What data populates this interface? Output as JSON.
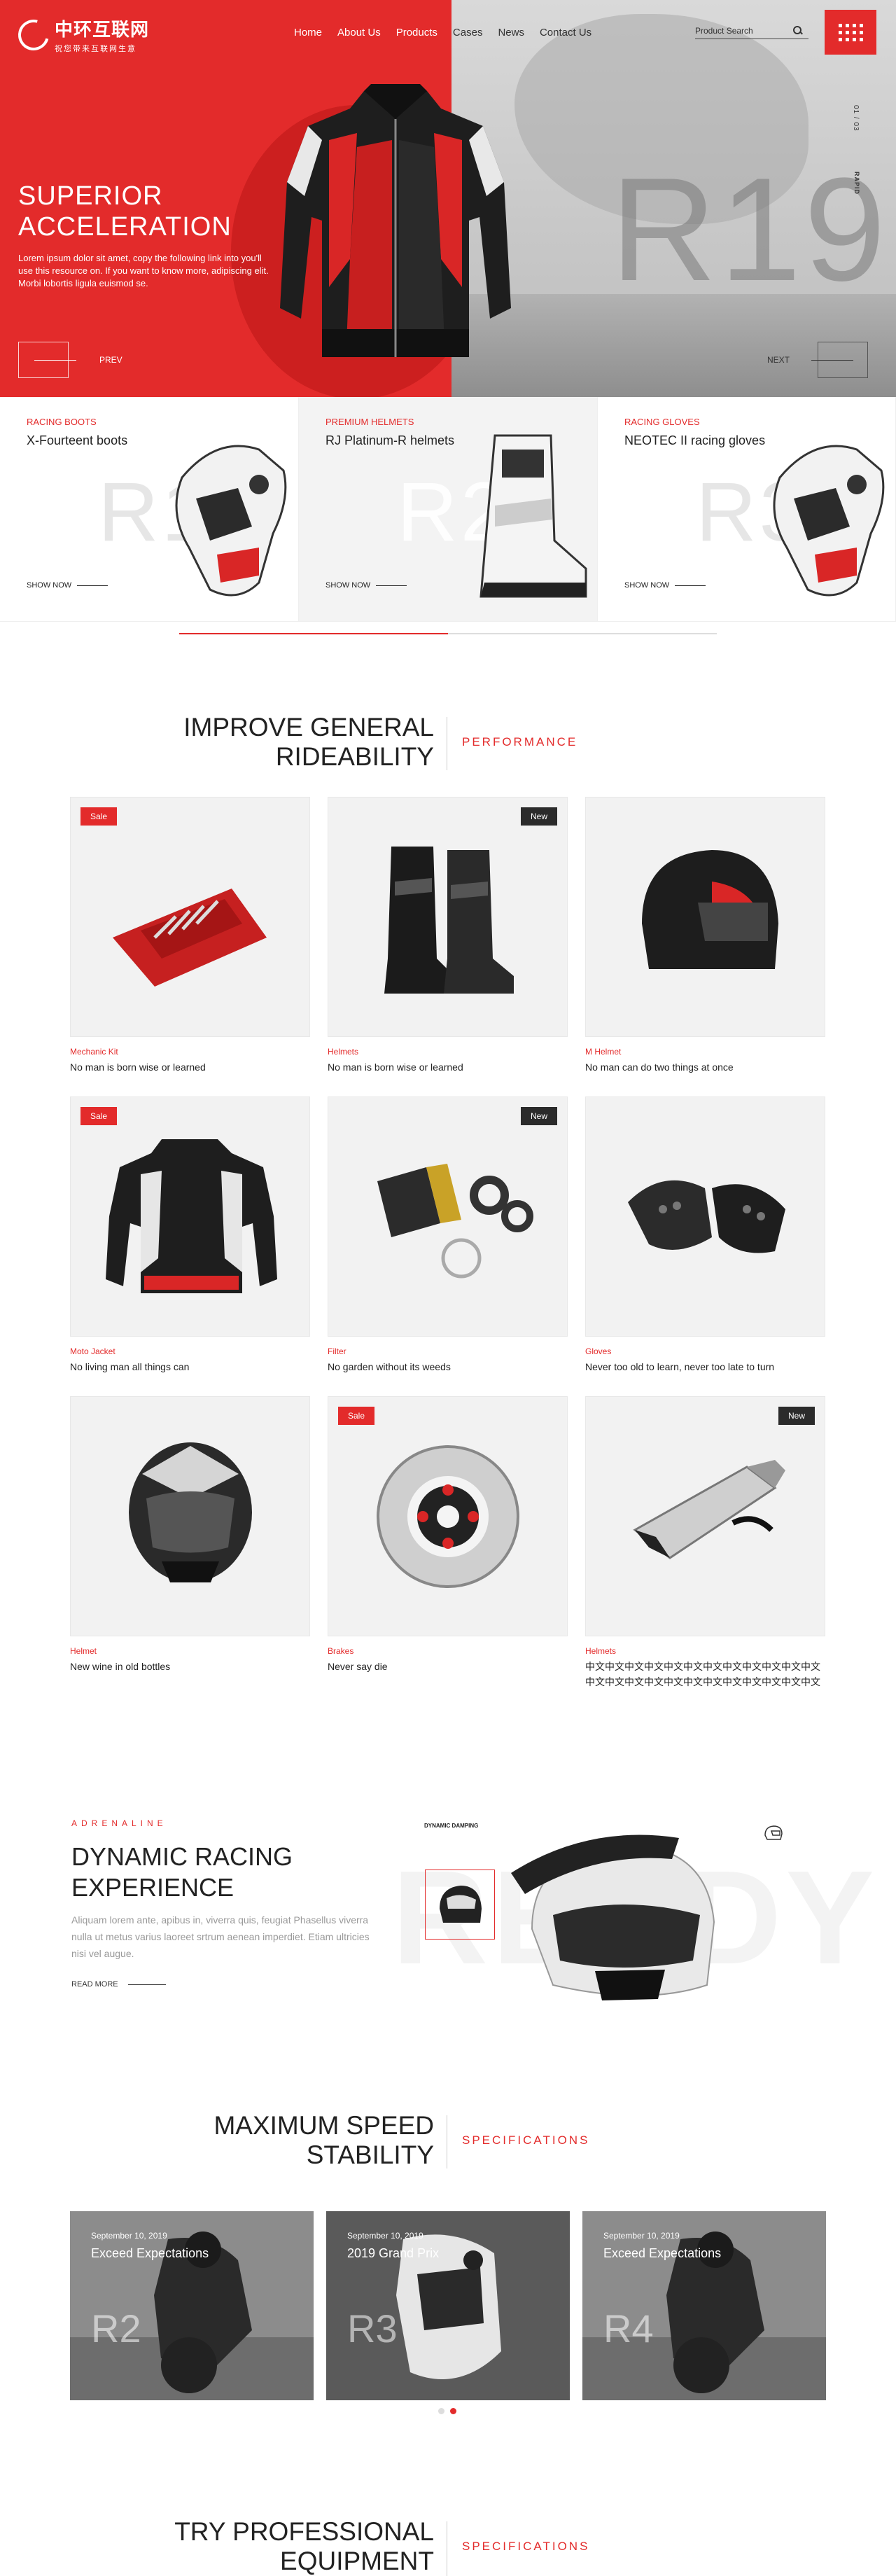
{
  "header": {
    "logo_cn": "中环互联网",
    "logo_sub": "祝您带来互联网生意",
    "nav": [
      "Home",
      "About Us",
      "Products",
      "Cases",
      "News",
      "Contact Us"
    ],
    "search_placeholder": "Product Search"
  },
  "hero": {
    "title_line1": "SUPERIOR",
    "title_line2": "ACCELERATION",
    "description": "Lorem ipsum dolor sit amet, copy the following link into you'll use this resource on. If you want to know more, adipiscing elit. Morbi lobortis ligula euismod se.",
    "big_text": "R19",
    "side_index": "01 / 03",
    "side_label": "RAPID",
    "prev_label": "PREV",
    "next_label": "NEXT",
    "brand_color": "#e32b2b"
  },
  "features": [
    {
      "category": "RACING BOOTS",
      "name": "X-Fourteent boots",
      "big": "R1",
      "more": "SHOW NOW"
    },
    {
      "category": "PREMIUM HELMETS",
      "name": "RJ Platinum-R helmets",
      "big": "R2",
      "more": "SHOW NOW"
    },
    {
      "category": "RACING GLOVES",
      "name": "NEOTEC II racing gloves",
      "big": "R3",
      "more": "SHOW NOW"
    }
  ],
  "performance": {
    "title_line1": "IMPROVE GENERAL",
    "title_line2": "RIDEABILITY",
    "subtitle": "PERFORMANCE"
  },
  "products": [
    {
      "category": "Mechanic Kit",
      "name": "No man is born wise or learned",
      "badge": "Sale",
      "icon": "tool-kit-icon"
    },
    {
      "category": "Helmets",
      "name": "No man is born wise or learned",
      "badge": "New",
      "icon": "boots-icon"
    },
    {
      "category": "M Helmet",
      "name": "No man can do two things at once",
      "badge": "",
      "icon": "helmet-icon"
    },
    {
      "category": "Moto Jacket",
      "name": "No living man all things can",
      "badge": "Sale",
      "icon": "jacket-icon"
    },
    {
      "category": "Filter",
      "name": "No garden without its weeds",
      "badge": "New",
      "icon": "filter-icon"
    },
    {
      "category": "Gloves",
      "name": "Never too old to learn, never too late to turn",
      "badge": "",
      "icon": "gloves-icon"
    },
    {
      "category": "Helmet",
      "name": "New wine in old bottles",
      "badge": "",
      "icon": "helmet-icon"
    },
    {
      "category": "Brakes",
      "name": "Never say die",
      "badge": "Sale",
      "icon": "brake-disc-icon"
    },
    {
      "category": "Helmets",
      "name": "中文中文中文中文中文中文中文中文中文中文中文中文中文中文中文中文中文中文中文中文中文中文中文中文中文中文中文中文中文中文",
      "badge": "New",
      "icon": "exhaust-icon"
    }
  ],
  "adrenaline": {
    "label": "ADRENALINE",
    "title_line1": "DYNAMIC RACING",
    "title_line2": "EXPERIENCE",
    "description": "Aliquam lorem ante, apibus in, viverra quis, feugiat Phasellus viverra nulla ut metus varius laoreet srtrum aenean imperdiet. Etiam ultricies nisi vel augue.",
    "more": "READ MORE",
    "big_word": "READY",
    "damping_label": "DYNAMIC DAMPING"
  },
  "specs": {
    "title_line1": "MAXIMUM SPEED",
    "title_line2": "STABILITY",
    "subtitle": "SPECIFICATIONS"
  },
  "news": [
    {
      "date": "September 10, 2019",
      "title": "Exceed Expectations",
      "big": "R2"
    },
    {
      "date": "September 10, 2019",
      "title": "2019 Grand Prix",
      "big": "R3"
    },
    {
      "date": "September 10, 2019",
      "title": "Exceed Expectations",
      "big": "R4"
    }
  ],
  "equipment": {
    "title_line1": "TRY PROFESSIONAL",
    "title_line2": "EQUIPMENT",
    "subtitle": "SPECIFICATIONS"
  }
}
